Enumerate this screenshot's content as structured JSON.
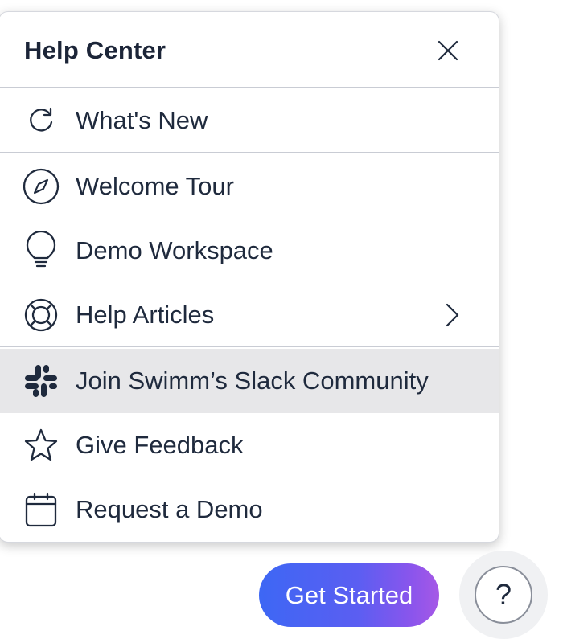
{
  "help_center": {
    "title": "Help Center",
    "items": [
      {
        "label": "What's New",
        "icon": "refresh-icon"
      },
      {
        "label": "Welcome Tour",
        "icon": "compass-icon"
      },
      {
        "label": "Demo Workspace",
        "icon": "lightbulb-icon"
      },
      {
        "label": "Help Articles",
        "icon": "lifebuoy-icon"
      },
      {
        "label": "Join Swimm’s Slack Community",
        "icon": "slack-icon"
      },
      {
        "label": "Give Feedback",
        "icon": "star-icon"
      },
      {
        "label": "Request a Demo",
        "icon": "calendar-icon"
      }
    ]
  },
  "get_started_label": "Get Started",
  "help_button_label": "?",
  "colors": {
    "text": "#1f2a3d",
    "divider": "#c9ccd4",
    "highlight_row": "#e7e7e9",
    "button_gradient_start": "#3d67f4",
    "button_gradient_end": "#a658e6"
  }
}
